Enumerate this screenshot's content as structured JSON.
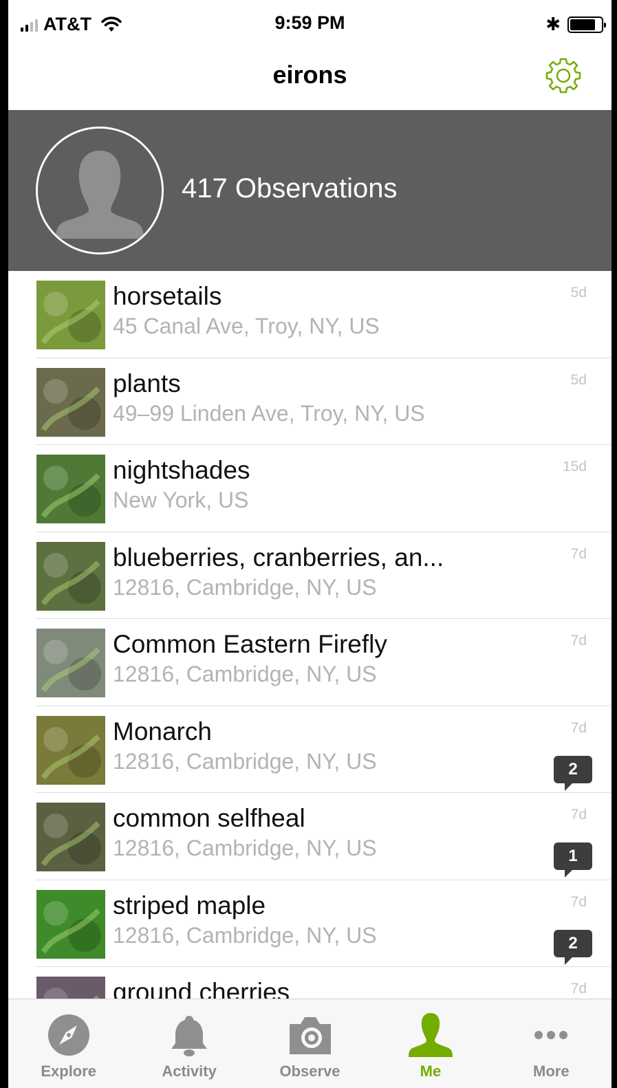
{
  "status_bar": {
    "carrier": "AT&T",
    "time": "9:59 PM"
  },
  "nav": {
    "title": "eirons",
    "settings_icon": "gear-icon"
  },
  "profile": {
    "observations_label": "417 Observations"
  },
  "observations": [
    {
      "title": "horsetails",
      "place": "45 Canal Ave, Troy, NY, US",
      "age": "5d",
      "comments": null,
      "thumb_color": "#7a9a3c"
    },
    {
      "title": "plants",
      "place": "49–99 Linden Ave, Troy, NY, US",
      "age": "5d",
      "comments": null,
      "thumb_color": "#6b6a4c"
    },
    {
      "title": "nightshades",
      "place": "New York, US",
      "age": "15d",
      "comments": null,
      "thumb_color": "#4e7a36"
    },
    {
      "title": "blueberries, cranberries, an...",
      "place": "12816, Cambridge, NY, US",
      "age": "7d",
      "comments": null,
      "thumb_color": "#5c7040"
    },
    {
      "title": "Common Eastern Firefly",
      "place": "12816, Cambridge, NY, US",
      "age": "7d",
      "comments": null,
      "thumb_color": "#7f8a7a"
    },
    {
      "title": "Monarch",
      "place": "12816, Cambridge, NY, US",
      "age": "7d",
      "comments": "2",
      "thumb_color": "#7a7a3a"
    },
    {
      "title": "common selfheal",
      "place": "12816, Cambridge, NY, US",
      "age": "7d",
      "comments": "1",
      "thumb_color": "#5b6040"
    },
    {
      "title": "striped maple",
      "place": "12816, Cambridge, NY, US",
      "age": "7d",
      "comments": "2",
      "thumb_color": "#3f8a2a"
    },
    {
      "title": "ground cherries",
      "place": "",
      "age": "7d",
      "comments": null,
      "thumb_color": "#6a5a6a"
    }
  ],
  "tabs": [
    {
      "label": "Explore",
      "icon": "compass-icon",
      "active": false
    },
    {
      "label": "Activity",
      "icon": "bell-icon",
      "active": false
    },
    {
      "label": "Observe",
      "icon": "camera-icon",
      "active": false
    },
    {
      "label": "Me",
      "icon": "person-icon",
      "active": true
    },
    {
      "label": "More",
      "icon": "ellipsis-icon",
      "active": false
    }
  ],
  "colors": {
    "accent": "#74ac00",
    "header_bg": "#5e5e5e",
    "badge_bg": "#3d3d3d",
    "tab_inactive": "#8a8a8a"
  }
}
